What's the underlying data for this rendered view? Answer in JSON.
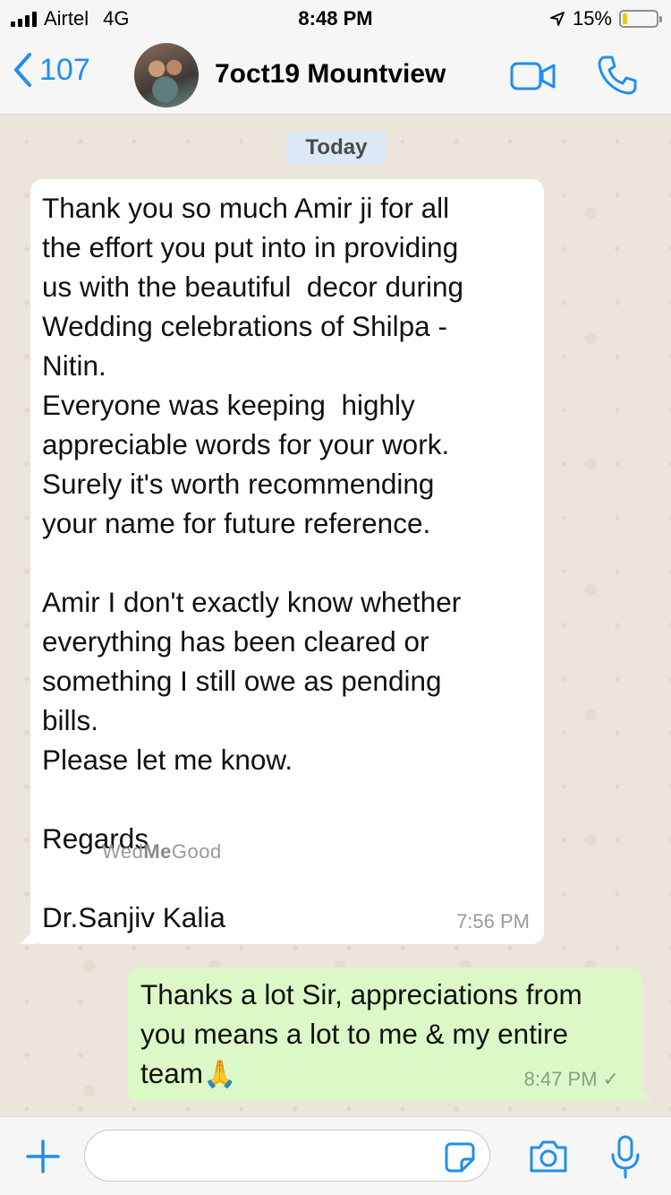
{
  "status_bar": {
    "carrier": "Airtel",
    "network": "4G",
    "time": "8:48 PM",
    "battery_percent": "15%",
    "battery_level": 0.15,
    "battery_color": "#f2c70f"
  },
  "header": {
    "back_count": "107",
    "chat_title": "7oct19 Mountview",
    "accent_color": "#1f8ef1",
    "icons": [
      "chevron-left-icon",
      "video-call-icon",
      "phone-icon"
    ]
  },
  "chat": {
    "date_label": "Today",
    "messages": [
      {
        "direction": "incoming",
        "text": "Thank you so much Amir ji for all\nthe effort you put into in providing\nus with the beautiful  decor during\nWedding celebrations of Shilpa -\nNitin.\nEveryone was keeping  highly\nappreciable words for your work.\nSurely it's worth recommending\nyour name for future reference.\n\nAmir I don't exactly know whether\neverything has been cleared or\nsomething I still owe as pending\nbills.\nPlease let me know.\n\nRegards\n\nDr.Sanjiv Kalia",
        "time": "7:56 PM"
      },
      {
        "direction": "outgoing",
        "text": "Thanks a lot Sir, appreciations from\nyou means a lot to me & my entire\nteam",
        "emoji": "🙏",
        "time": "8:47 PM",
        "status": "✓"
      }
    ],
    "watermark": {
      "part1": "Wed",
      "part2": "Me",
      "part3": "Good"
    }
  },
  "input_bar": {
    "placeholder": "",
    "icons": [
      "plus-icon",
      "sticker-icon",
      "camera-icon",
      "microphone-icon"
    ]
  }
}
